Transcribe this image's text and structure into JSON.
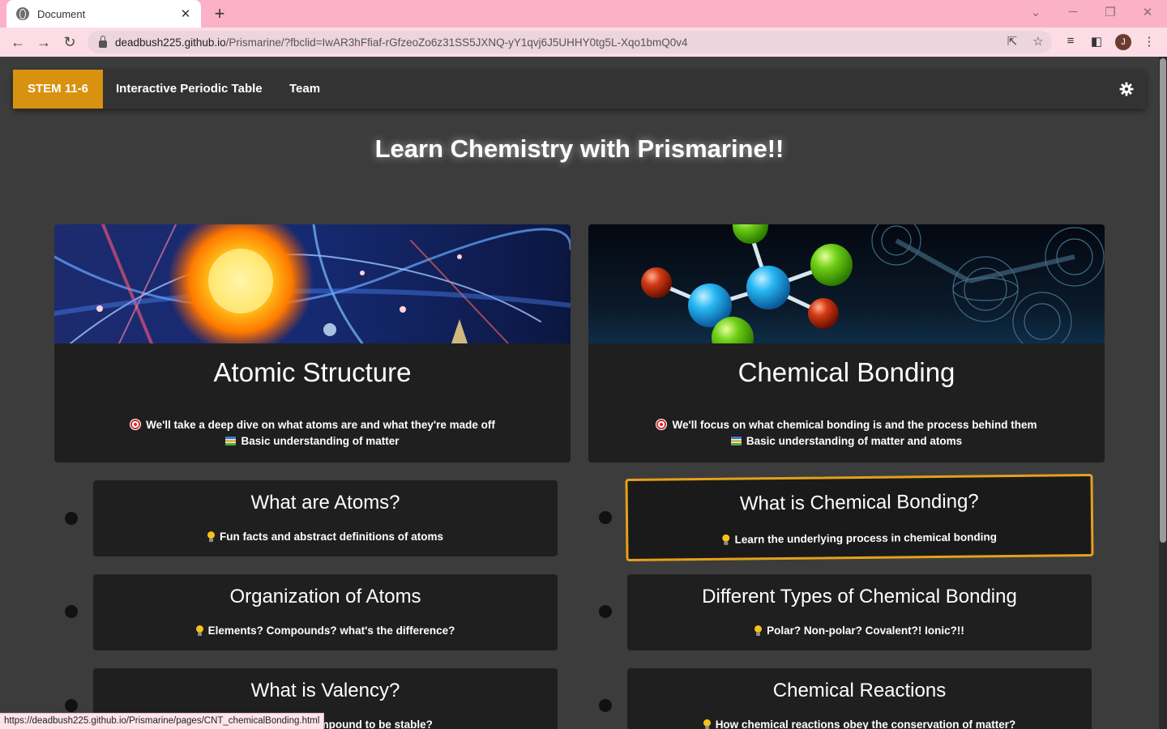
{
  "browser": {
    "tab_title": "Document",
    "tab_close": "✕",
    "new_tab": "+",
    "url_host": "deadbush225.github.io",
    "url_path": "/Prismarine/?fbclid=IwAR3hFfiaf-rGfzeoZo6z31SS5JXNQ-yY1qvj6J5UHHY0tg5L-Xqo1bmQ0v4",
    "profile_initial": "J",
    "status_url": "https://deadbush225.github.io/Prismarine/pages/CNT_chemicalBonding.html",
    "icons": [
      "back-icon",
      "forward-icon",
      "reload-icon",
      "lock-icon",
      "share-icon",
      "star-icon",
      "media-icon",
      "sidepanel-icon",
      "menu-icon"
    ]
  },
  "navbar": {
    "brand": "STEM 11-6",
    "links": [
      "Interactive Periodic Table",
      "Team"
    ],
    "theme_icon": "gear-icon"
  },
  "hero": {
    "title": "Learn Chemistry with Prismarine!!"
  },
  "cards": [
    {
      "title": "Atomic Structure",
      "goal": "We'll take a deep dive on what atoms are and what they're made off",
      "prereq": "Basic understanding of matter"
    },
    {
      "title": "Chemical Bonding",
      "goal": "We'll focus on what chemical bonding is and the process behind them",
      "prereq": "Basic understanding of matter and atoms"
    }
  ],
  "left_lessons": [
    {
      "title": "What are Atoms?",
      "desc": "Fun facts and abstract definitions of atoms"
    },
    {
      "title": "Organization of Atoms",
      "desc": "Elements? Compounds? what's the difference?"
    },
    {
      "title": "What is Valency?",
      "desc": "What makes a compound to be stable?"
    }
  ],
  "right_lessons": [
    {
      "title": "What is Chemical Bonding?",
      "desc": "Learn the underlying process in chemical bonding"
    },
    {
      "title": "Different Types of Chemical Bonding",
      "desc": "Polar? Non-polar? Covalent?! Ionic?!!"
    },
    {
      "title": "Chemical Reactions",
      "desc": "How chemical reactions obey the conservation of matter?"
    }
  ],
  "colors": {
    "accent": "#d8920f",
    "card_bg": "#1f1f1f",
    "page_bg": "#3c3c3c",
    "highlight": "#e5a019"
  }
}
